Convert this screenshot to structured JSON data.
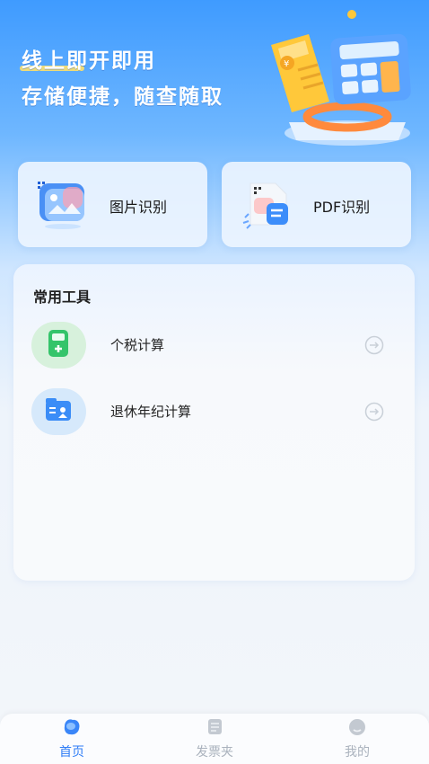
{
  "hero": {
    "line1": "线上即开即用",
    "line2": "存储便捷，随查随取"
  },
  "features": [
    {
      "label": "图片识别",
      "icon": "image-recognition-icon"
    },
    {
      "label": "PDF识别",
      "icon": "pdf-recognition-icon"
    }
  ],
  "tools": {
    "title": "常用工具",
    "items": [
      {
        "label": "个税计算",
        "icon": "tax-calculator-icon",
        "arrow": "arrow-right-circle-icon"
      },
      {
        "label": "退休年纪计算",
        "icon": "retirement-calculator-icon",
        "arrow": "arrow-right-circle-icon"
      }
    ]
  },
  "nav": [
    {
      "label": "首页",
      "icon": "home-icon",
      "active": true
    },
    {
      "label": "发票夹",
      "icon": "invoice-folder-icon",
      "active": false
    },
    {
      "label": "我的",
      "icon": "profile-icon",
      "active": false
    }
  ],
  "colors": {
    "primary": "#2f7df6",
    "inactive": "#aab2bd",
    "tax_icon_bg": "#d7f1dc",
    "retire_icon_bg": "#d6e9fb"
  }
}
